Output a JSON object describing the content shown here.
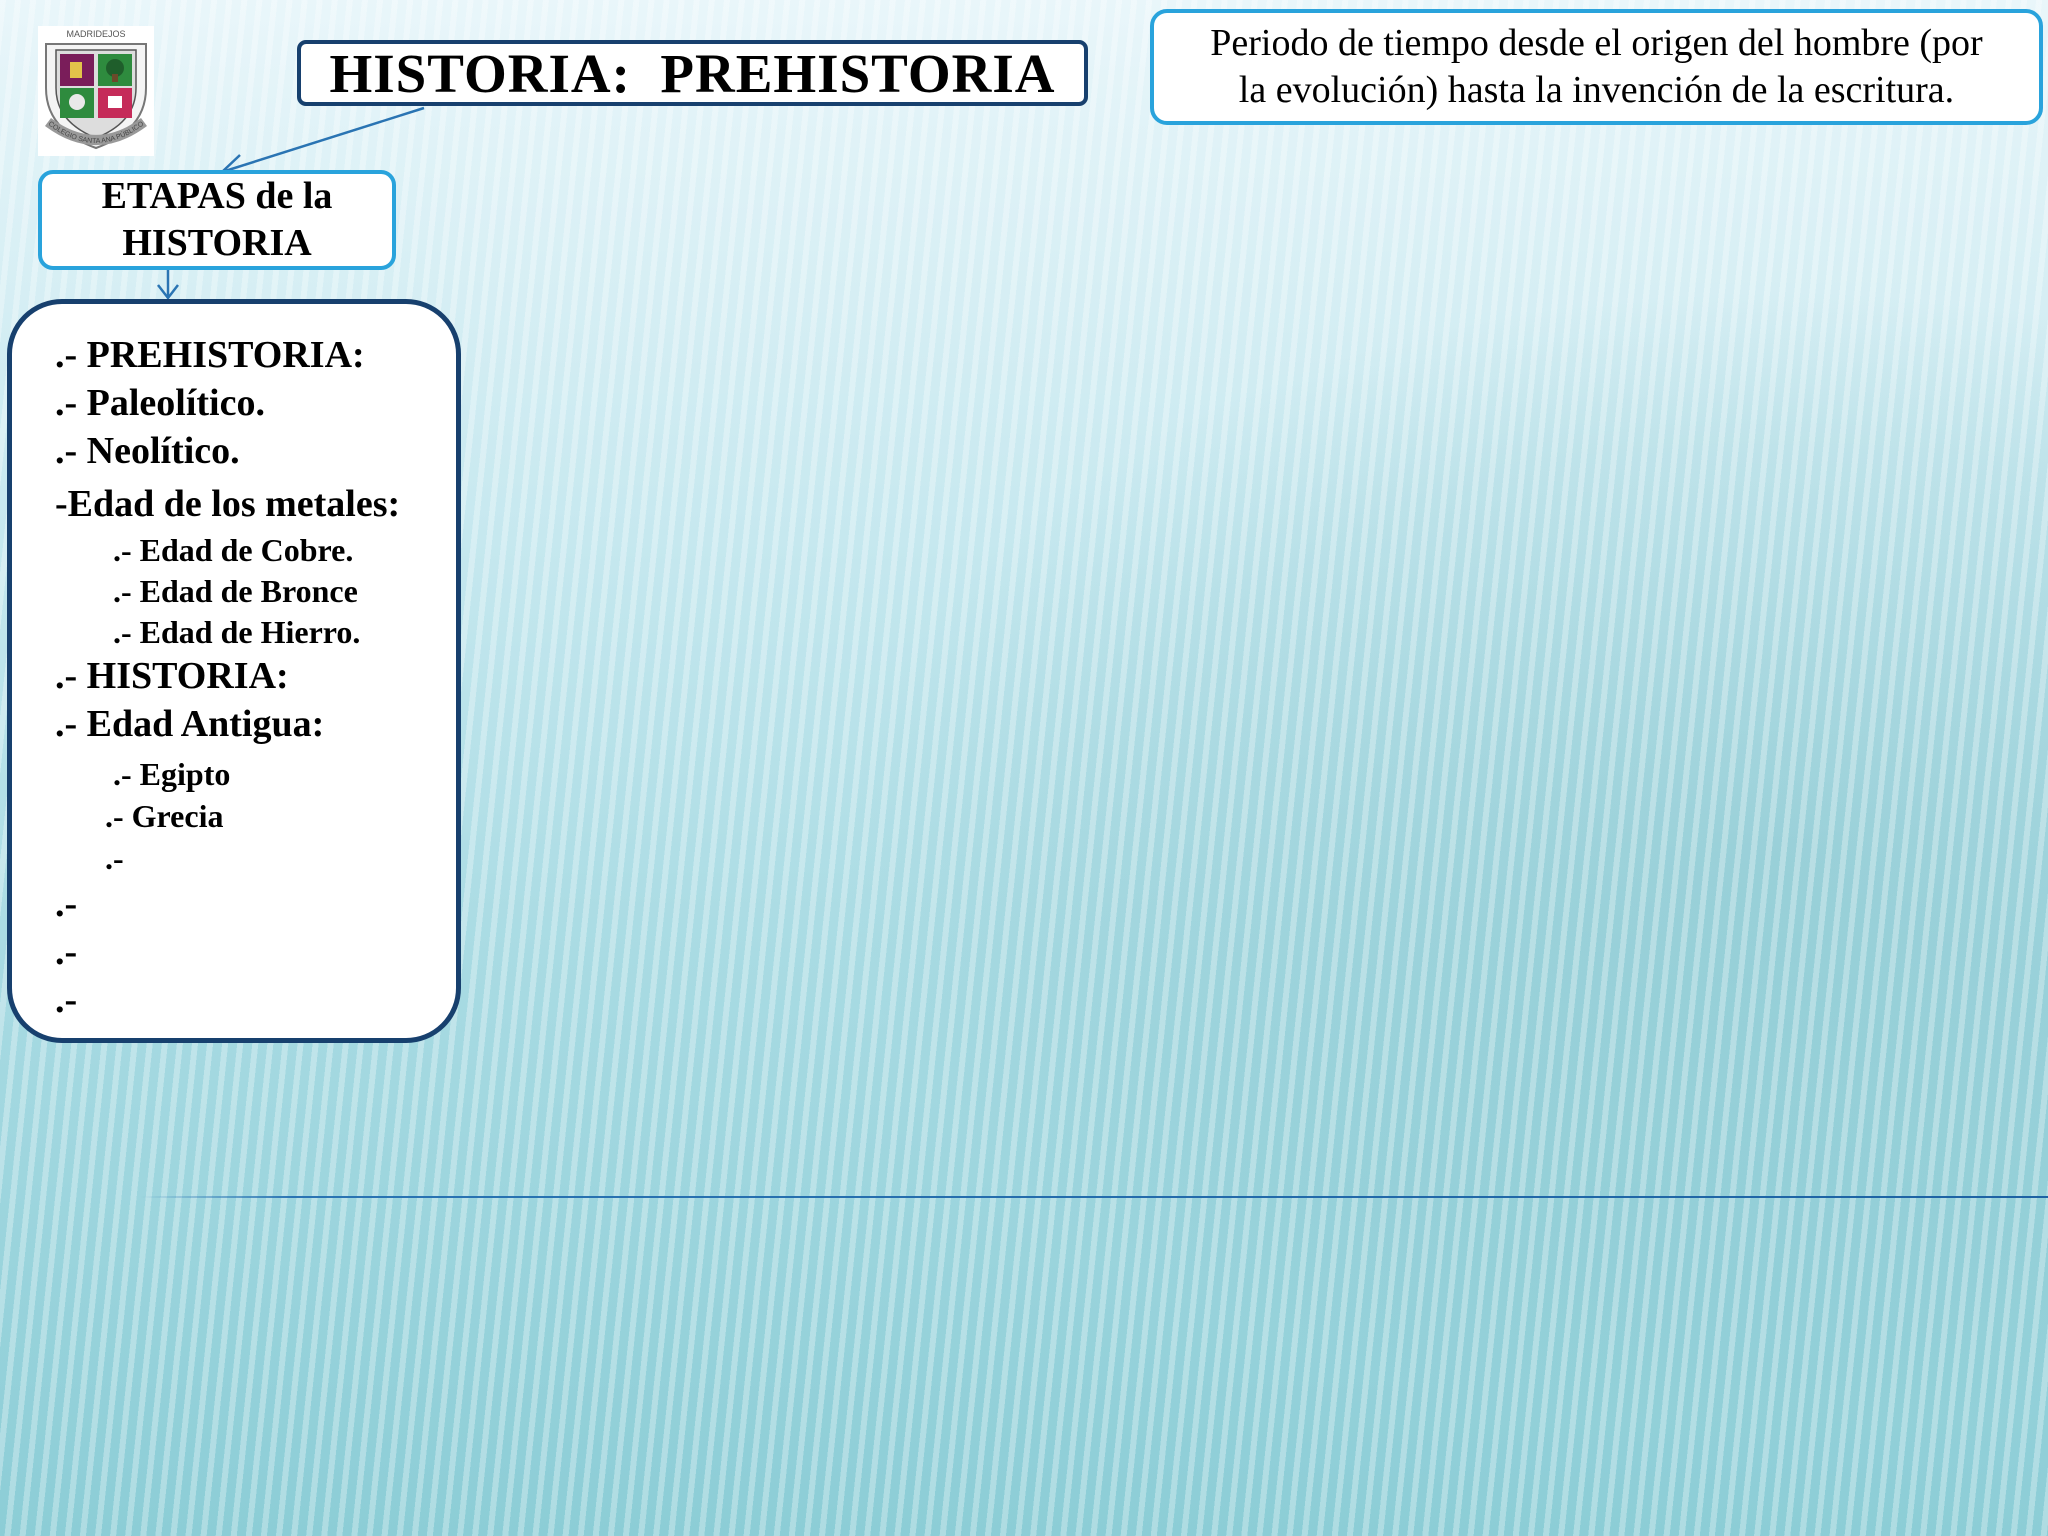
{
  "title": "HISTORIA:  PREHISTORIA",
  "definition": "Periodo de tiempo desde el origen  del hombre (por\nla evolución) hasta la invención de la escritura.",
  "etapas_box": "ETAPAS de la\nHISTORIA",
  "logo": {
    "top_text": "MADRIDEJOS",
    "bottom_text": "COLEGIO SANTA ANA PÚBLICO"
  },
  "list": [
    {
      "text": ".- PREHISTORIA:"
    },
    {
      "text": ".- Paleolítico."
    },
    {
      "text": ".- Neolítico."
    },
    {
      "text": "-Edad de los metales:"
    },
    {
      "text": ".- Edad de Cobre."
    },
    {
      "text": ".- Edad de Bronce"
    },
    {
      "text": ".- Edad de Hierro."
    },
    {
      "text": ".- HISTORIA:"
    },
    {
      "text": ".- Edad Antigua:"
    },
    {
      "text": ".- Egipto"
    },
    {
      "text": ".- Grecia"
    },
    {
      "text": ".-"
    },
    {
      "text": ".-"
    },
    {
      "text": ".-"
    },
    {
      "text": ".-"
    }
  ],
  "colors": {
    "title_border": "#17406e",
    "box_border": "#29a3dc",
    "connector": "#2a74b3",
    "line": "#1d62a3"
  }
}
